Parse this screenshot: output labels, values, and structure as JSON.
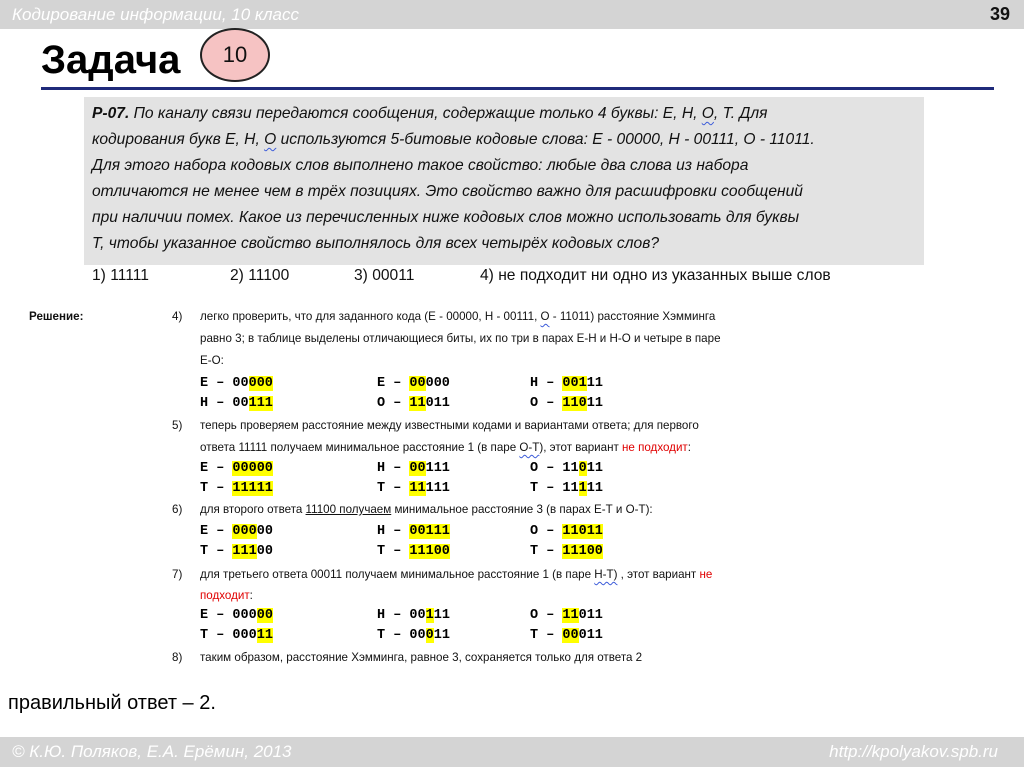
{
  "header": {
    "title": "Кодирование информации, 10 класс",
    "page": "39"
  },
  "heading": "Задача",
  "badge": "10",
  "task": {
    "id": "Р-07.",
    "lines": [
      " По каналу связи передаются сообщения, содержащие только 4 буквы: Е, Н, ",
      "кодирования букв Е, Н, ",
      "Для этого набора кодовых слов выполнено такое свойство: любые два слова из набора",
      "отличаются не менее чем в трёх позициях. Это свойство важно для расшифровки сообщений",
      "при наличии помех. Какое из перечисленных ниже кодовых слов можно использовать для буквы",
      "Т, чтобы указанное свойство выполнялось для всех четырёх кодовых слов?"
    ],
    "o_letter": "О",
    "line1_end": ", Т. Для",
    "line2_end": " используются 5-битовые кодовые слова: Е - 00000, Н - 00111, О - 11011.",
    "options": [
      "1) 11111",
      "2) 11100",
      "3) 00011",
      "4) не подходит ни одно из указанных выше слов"
    ]
  },
  "solution": {
    "label": "Решение:",
    "steps": {
      "s4_num": "4)",
      "s4_l1a": "легко проверить, что для заданного кода (Е - 00000, Н - 00111, ",
      "s4_l1o": "О",
      "s4_l1b": " - 11011) расстояние Хэмминга",
      "s4_l2": "равно 3; в таблице выделены отличающиеся биты, их по три в парах Е-Н и Н-О и четыре в паре",
      "s4_l3": "Е-О:",
      "s5_num": "5)",
      "s5_l1": "теперь проверяем расстояние между известными кодами и вариантами ответа; для первого",
      "s5_l2a": "ответа 11111 получаем минимальное расстояние 1 (в паре ",
      "s5_l2ot": "О-Т",
      "s5_l2b": "), этот вариант ",
      "s5_l2red": "не подходит",
      "s5_l2c": ":",
      "s6_num": "6)",
      "s6_l1a": "для второго ответа ",
      "s6_l1u": "11100  получаем",
      "s6_l1b": " минимальное расстояние 3 (в парах Е-Т и О-Т):",
      "s7_num": "7)",
      "s7_l1a": "для третьего ответа 00011 получаем минимальное расстояние 1 (в паре ",
      "s7_l1u": "Н-Т)",
      "s7_l1b": " , этот вариант ",
      "s7_l1red": "не",
      "s7_l2red": "подходит",
      "s7_l2b": ":",
      "s8_num": "8)",
      "s8_l1": "таким образом, расстояние Хэмминга, равное 3, сохраняется только для ответа 2"
    },
    "codes": {
      "g1": [
        [
          "Е – 00",
          "000",
          ""
        ],
        [
          "Н – 00",
          "111",
          ""
        ],
        [
          "Е – ",
          "00",
          "000"
        ],
        [
          "О – ",
          "11",
          "011"
        ],
        [
          "Н – ",
          "001",
          "11"
        ],
        [
          "О – ",
          "110",
          "11"
        ]
      ],
      "g2": [
        [
          "Е – ",
          "00000",
          ""
        ],
        [
          "Т – ",
          "11111",
          ""
        ],
        [
          "Н – ",
          "00",
          "111"
        ],
        [
          "Т – ",
          "11",
          "111"
        ],
        [
          "О – 11",
          "0",
          "11"
        ],
        [
          "Т – 11",
          "1",
          "11"
        ]
      ],
      "g3": [
        [
          "Е – ",
          "000",
          "00"
        ],
        [
          "Т – ",
          "111",
          "00"
        ],
        [
          "Н – ",
          "00111",
          ""
        ],
        [
          "Т – ",
          "11100",
          ""
        ],
        [
          "О – ",
          "11011",
          ""
        ],
        [
          "Т – ",
          "11100",
          ""
        ]
      ],
      "g4": [
        [
          "Е – 000",
          "00",
          ""
        ],
        [
          "Т – 000",
          "11",
          ""
        ],
        [
          "Н – 00",
          "1",
          "11"
        ],
        [
          "Т – 00",
          "0",
          "11"
        ],
        [
          "О – ",
          "11",
          "011"
        ],
        [
          "Т – ",
          "00",
          "011"
        ]
      ]
    }
  },
  "answer": "правильный ответ – 2.",
  "footer": {
    "left": "© К.Ю. Поляков, Е.А. Ерёмин, 2013",
    "right": "http://kpolyakov.spb.ru"
  }
}
